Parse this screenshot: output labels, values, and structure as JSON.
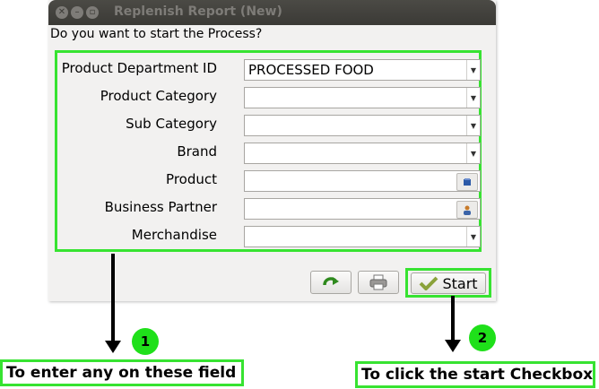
{
  "window": {
    "title": "Replenish Report (New)",
    "question": "Do you want to start the Process?"
  },
  "form": {
    "fields": [
      {
        "label": "Product Department ID",
        "value": "PROCESSED FOOD",
        "control": "dropdown"
      },
      {
        "label": "Product Category",
        "value": "",
        "control": "dropdown"
      },
      {
        "label": "Sub Category",
        "value": "",
        "control": "dropdown"
      },
      {
        "label": "Brand",
        "value": "",
        "control": "dropdown"
      },
      {
        "label": "Product",
        "value": "",
        "control": "lookup"
      },
      {
        "label": "Business Partner",
        "value": "",
        "control": "lookup"
      },
      {
        "label": "Merchandise",
        "value": "",
        "control": "dropdown"
      }
    ]
  },
  "buttons": {
    "start_label": "Start"
  },
  "annotations": {
    "step1_number": "1",
    "step1_caption": "To enter any on these field",
    "step2_number": "2",
    "step2_caption": "To click the start Checkbox"
  },
  "colors": {
    "highlight": "#37e331",
    "step_circle": "#1fe01a",
    "titlebar": "#3b3a36"
  }
}
